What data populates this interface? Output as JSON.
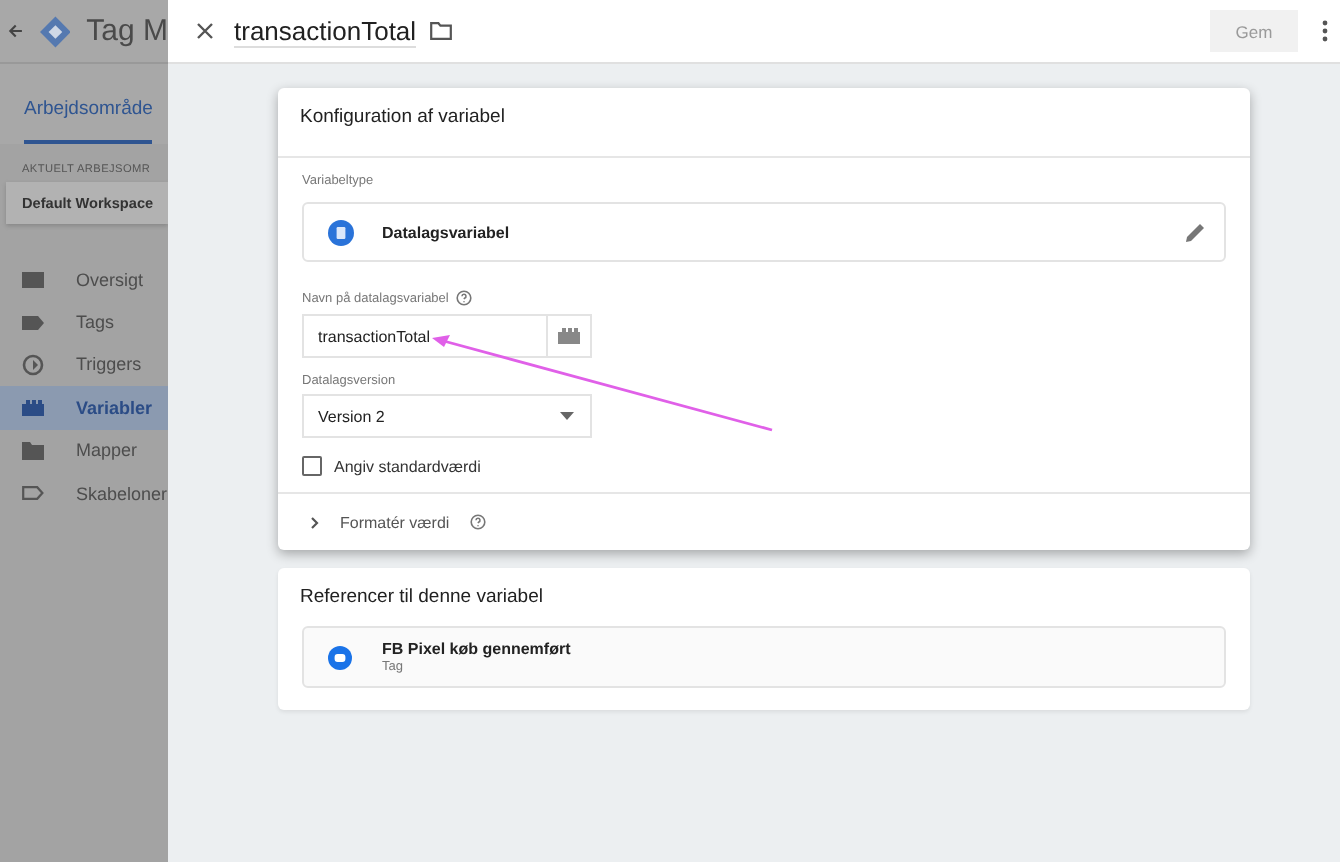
{
  "sidebar": {
    "app_title": "Tag M",
    "tab": {
      "label": "Arbejdsområde",
      "selected": true
    },
    "workspace_label": "AKTUELT ARBEJSOMR",
    "workspace": "Default Workspace",
    "items": [
      {
        "label": "Oversigt",
        "kind": "briefcase",
        "selected": false
      },
      {
        "label": "Tags",
        "kind": "tag",
        "selected": false
      },
      {
        "label": "Triggers",
        "kind": "trigger",
        "selected": false
      },
      {
        "label": "Variabler",
        "kind": "blocks",
        "selected": true
      },
      {
        "label": "Mapper",
        "kind": "folder",
        "selected": false
      },
      {
        "label": "Skabeloner",
        "kind": "outline",
        "selected": false
      }
    ]
  },
  "panel": {
    "title": "transactionTotal",
    "save_button": {
      "label": "Gem",
      "disabled": true
    },
    "config_card": {
      "title": "Konfiguration af variabel",
      "type_label": "Variabeltype",
      "type_name": "Datalagsvariabel",
      "name_label": "Navn på datalagsvariabel",
      "name_value": "transactionTotal",
      "version_label": "Datalagsversion",
      "version_value": "Version 2",
      "default_checkbox": {
        "label": "Angiv standardværdi",
        "checked": false
      },
      "format_label": "Formatér værdi",
      "format_expanded": false
    },
    "references_card": {
      "title": "Referencer til denne variabel",
      "items": [
        {
          "name": "FB Pixel køb gennemført",
          "type": "Tag"
        }
      ]
    }
  }
}
